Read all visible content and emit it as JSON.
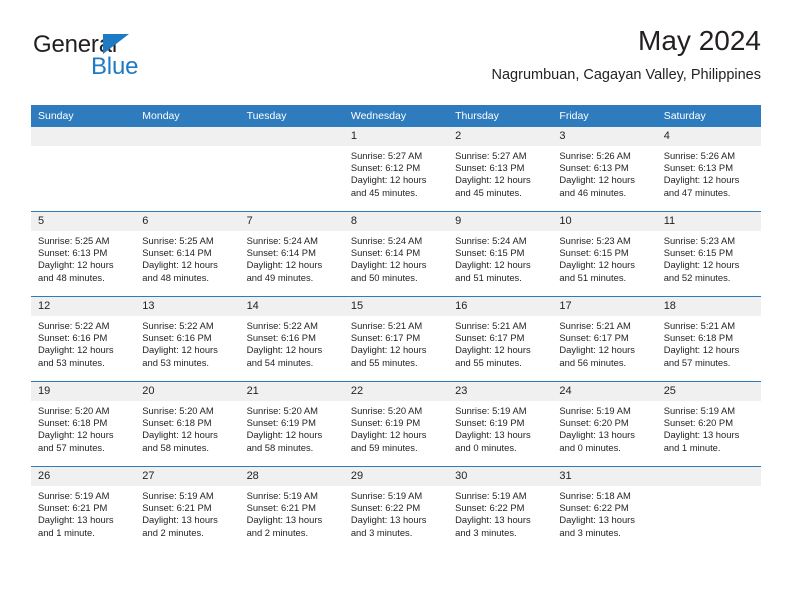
{
  "brand": {
    "name_part1": "General",
    "name_part2": "Blue",
    "triangle_color": "#1f7ac4",
    "text_color": "#231f20"
  },
  "header": {
    "title": "May 2024",
    "subtitle": "Nagrumbuan, Cagayan Valley, Philippines",
    "accent_color": "#2e7cbe"
  },
  "calendar": {
    "weekday_headers": [
      "Sunday",
      "Monday",
      "Tuesday",
      "Wednesday",
      "Thursday",
      "Friday",
      "Saturday"
    ],
    "labels": {
      "sunrise_prefix": "Sunrise:",
      "sunset_prefix": "Sunset:",
      "daylight_prefix": "Daylight:"
    },
    "weeks": [
      [
        {
          "day": "",
          "blank": true
        },
        {
          "day": "",
          "blank": true
        },
        {
          "day": "",
          "blank": true
        },
        {
          "day": "1",
          "sunrise": "Sunrise: 5:27 AM",
          "sunset": "Sunset: 6:12 PM",
          "daylight_line1": "Daylight: 12 hours",
          "daylight_line2": "and 45 minutes."
        },
        {
          "day": "2",
          "sunrise": "Sunrise: 5:27 AM",
          "sunset": "Sunset: 6:13 PM",
          "daylight_line1": "Daylight: 12 hours",
          "daylight_line2": "and 45 minutes."
        },
        {
          "day": "3",
          "sunrise": "Sunrise: 5:26 AM",
          "sunset": "Sunset: 6:13 PM",
          "daylight_line1": "Daylight: 12 hours",
          "daylight_line2": "and 46 minutes."
        },
        {
          "day": "4",
          "sunrise": "Sunrise: 5:26 AM",
          "sunset": "Sunset: 6:13 PM",
          "daylight_line1": "Daylight: 12 hours",
          "daylight_line2": "and 47 minutes."
        }
      ],
      [
        {
          "day": "5",
          "sunrise": "Sunrise: 5:25 AM",
          "sunset": "Sunset: 6:13 PM",
          "daylight_line1": "Daylight: 12 hours",
          "daylight_line2": "and 48 minutes."
        },
        {
          "day": "6",
          "sunrise": "Sunrise: 5:25 AM",
          "sunset": "Sunset: 6:14 PM",
          "daylight_line1": "Daylight: 12 hours",
          "daylight_line2": "and 48 minutes."
        },
        {
          "day": "7",
          "sunrise": "Sunrise: 5:24 AM",
          "sunset": "Sunset: 6:14 PM",
          "daylight_line1": "Daylight: 12 hours",
          "daylight_line2": "and 49 minutes."
        },
        {
          "day": "8",
          "sunrise": "Sunrise: 5:24 AM",
          "sunset": "Sunset: 6:14 PM",
          "daylight_line1": "Daylight: 12 hours",
          "daylight_line2": "and 50 minutes."
        },
        {
          "day": "9",
          "sunrise": "Sunrise: 5:24 AM",
          "sunset": "Sunset: 6:15 PM",
          "daylight_line1": "Daylight: 12 hours",
          "daylight_line2": "and 51 minutes."
        },
        {
          "day": "10",
          "sunrise": "Sunrise: 5:23 AM",
          "sunset": "Sunset: 6:15 PM",
          "daylight_line1": "Daylight: 12 hours",
          "daylight_line2": "and 51 minutes."
        },
        {
          "day": "11",
          "sunrise": "Sunrise: 5:23 AM",
          "sunset": "Sunset: 6:15 PM",
          "daylight_line1": "Daylight: 12 hours",
          "daylight_line2": "and 52 minutes."
        }
      ],
      [
        {
          "day": "12",
          "sunrise": "Sunrise: 5:22 AM",
          "sunset": "Sunset: 6:16 PM",
          "daylight_line1": "Daylight: 12 hours",
          "daylight_line2": "and 53 minutes."
        },
        {
          "day": "13",
          "sunrise": "Sunrise: 5:22 AM",
          "sunset": "Sunset: 6:16 PM",
          "daylight_line1": "Daylight: 12 hours",
          "daylight_line2": "and 53 minutes."
        },
        {
          "day": "14",
          "sunrise": "Sunrise: 5:22 AM",
          "sunset": "Sunset: 6:16 PM",
          "daylight_line1": "Daylight: 12 hours",
          "daylight_line2": "and 54 minutes."
        },
        {
          "day": "15",
          "sunrise": "Sunrise: 5:21 AM",
          "sunset": "Sunset: 6:17 PM",
          "daylight_line1": "Daylight: 12 hours",
          "daylight_line2": "and 55 minutes."
        },
        {
          "day": "16",
          "sunrise": "Sunrise: 5:21 AM",
          "sunset": "Sunset: 6:17 PM",
          "daylight_line1": "Daylight: 12 hours",
          "daylight_line2": "and 55 minutes."
        },
        {
          "day": "17",
          "sunrise": "Sunrise: 5:21 AM",
          "sunset": "Sunset: 6:17 PM",
          "daylight_line1": "Daylight: 12 hours",
          "daylight_line2": "and 56 minutes."
        },
        {
          "day": "18",
          "sunrise": "Sunrise: 5:21 AM",
          "sunset": "Sunset: 6:18 PM",
          "daylight_line1": "Daylight: 12 hours",
          "daylight_line2": "and 57 minutes."
        }
      ],
      [
        {
          "day": "19",
          "sunrise": "Sunrise: 5:20 AM",
          "sunset": "Sunset: 6:18 PM",
          "daylight_line1": "Daylight: 12 hours",
          "daylight_line2": "and 57 minutes."
        },
        {
          "day": "20",
          "sunrise": "Sunrise: 5:20 AM",
          "sunset": "Sunset: 6:18 PM",
          "daylight_line1": "Daylight: 12 hours",
          "daylight_line2": "and 58 minutes."
        },
        {
          "day": "21",
          "sunrise": "Sunrise: 5:20 AM",
          "sunset": "Sunset: 6:19 PM",
          "daylight_line1": "Daylight: 12 hours",
          "daylight_line2": "and 58 minutes."
        },
        {
          "day": "22",
          "sunrise": "Sunrise: 5:20 AM",
          "sunset": "Sunset: 6:19 PM",
          "daylight_line1": "Daylight: 12 hours",
          "daylight_line2": "and 59 minutes."
        },
        {
          "day": "23",
          "sunrise": "Sunrise: 5:19 AM",
          "sunset": "Sunset: 6:19 PM",
          "daylight_line1": "Daylight: 13 hours",
          "daylight_line2": "and 0 minutes."
        },
        {
          "day": "24",
          "sunrise": "Sunrise: 5:19 AM",
          "sunset": "Sunset: 6:20 PM",
          "daylight_line1": "Daylight: 13 hours",
          "daylight_line2": "and 0 minutes."
        },
        {
          "day": "25",
          "sunrise": "Sunrise: 5:19 AM",
          "sunset": "Sunset: 6:20 PM",
          "daylight_line1": "Daylight: 13 hours",
          "daylight_line2": "and 1 minute."
        }
      ],
      [
        {
          "day": "26",
          "sunrise": "Sunrise: 5:19 AM",
          "sunset": "Sunset: 6:21 PM",
          "daylight_line1": "Daylight: 13 hours",
          "daylight_line2": "and 1 minute."
        },
        {
          "day": "27",
          "sunrise": "Sunrise: 5:19 AM",
          "sunset": "Sunset: 6:21 PM",
          "daylight_line1": "Daylight: 13 hours",
          "daylight_line2": "and 2 minutes."
        },
        {
          "day": "28",
          "sunrise": "Sunrise: 5:19 AM",
          "sunset": "Sunset: 6:21 PM",
          "daylight_line1": "Daylight: 13 hours",
          "daylight_line2": "and 2 minutes."
        },
        {
          "day": "29",
          "sunrise": "Sunrise: 5:19 AM",
          "sunset": "Sunset: 6:22 PM",
          "daylight_line1": "Daylight: 13 hours",
          "daylight_line2": "and 3 minutes."
        },
        {
          "day": "30",
          "sunrise": "Sunrise: 5:19 AM",
          "sunset": "Sunset: 6:22 PM",
          "daylight_line1": "Daylight: 13 hours",
          "daylight_line2": "and 3 minutes."
        },
        {
          "day": "31",
          "sunrise": "Sunrise: 5:18 AM",
          "sunset": "Sunset: 6:22 PM",
          "daylight_line1": "Daylight: 13 hours",
          "daylight_line2": "and 3 minutes."
        },
        {
          "day": "",
          "blank": true
        }
      ]
    ]
  }
}
